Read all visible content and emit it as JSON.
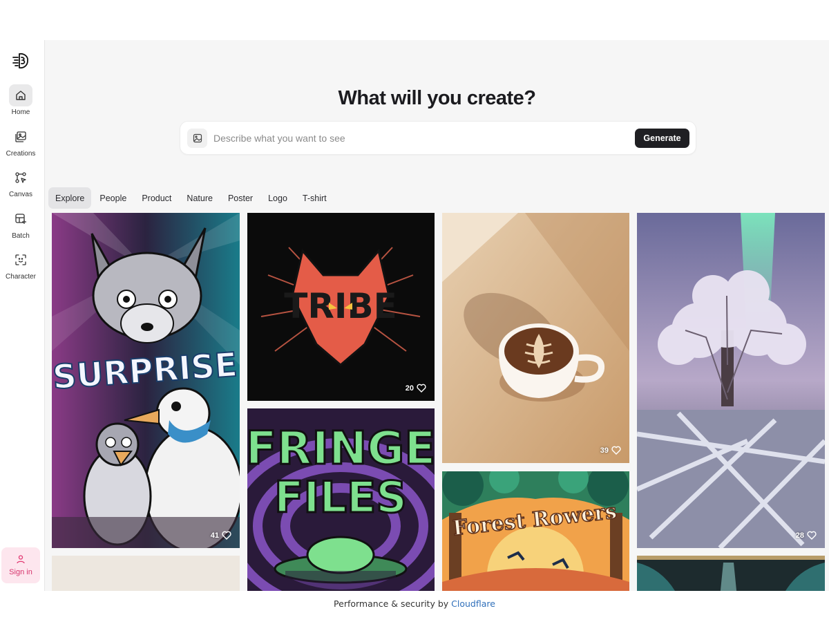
{
  "nav": {
    "items": [
      {
        "label": "Home",
        "icon": "home-icon",
        "active": true
      },
      {
        "label": "Creations",
        "icon": "images-icon"
      },
      {
        "label": "Canvas",
        "icon": "canvas-icon"
      },
      {
        "label": "Batch",
        "icon": "batch-icon"
      },
      {
        "label": "Character",
        "icon": "character-icon"
      }
    ],
    "sign_in": "Sign in"
  },
  "hero": {
    "title": "What will you create?",
    "placeholder": "Describe what you want to see",
    "generate": "Generate"
  },
  "tabs": [
    "Explore",
    "People",
    "Product",
    "Nature",
    "Poster",
    "Logo",
    "T-shirt"
  ],
  "gallery": {
    "surprise": {
      "text": "SURPRISE",
      "likes": "41"
    },
    "tribe": {
      "text": "TRIBE",
      "likes": "20"
    },
    "fringe": {
      "line1": "FRINGE",
      "line2": "FILES"
    },
    "coffee": {
      "likes": "39"
    },
    "forest": {
      "text": "Forest Rowers"
    },
    "tree": {
      "likes": "28"
    }
  },
  "footer": {
    "prefix": "Performance & security by",
    "link": "Cloudflare"
  },
  "colors": {
    "accent_pink": "#e23a73",
    "dark": "#1f1f23",
    "link": "#2f6fba"
  }
}
